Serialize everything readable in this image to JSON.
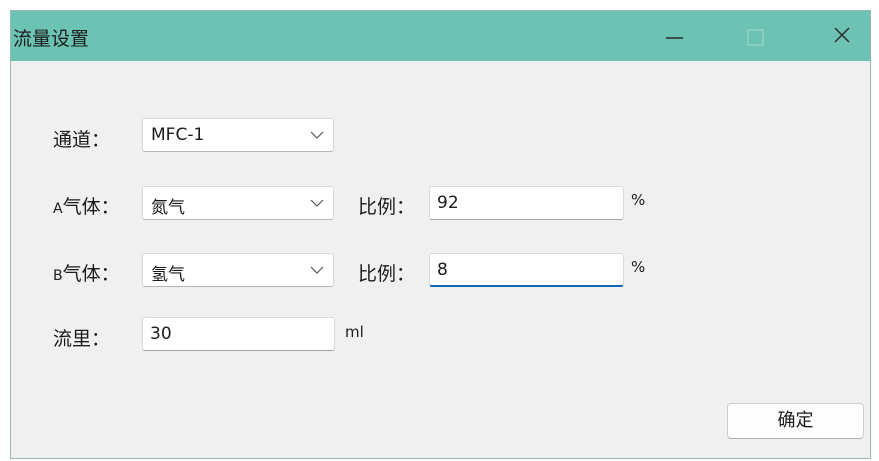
{
  "window": {
    "title": "流量设置",
    "titlebar_color": "#6cc2b3"
  },
  "titlebar_buttons": {
    "minimize": "minimize-icon",
    "maximize": "maximize-icon",
    "close": "close-icon"
  },
  "channel": {
    "label": "通道：",
    "value": "MFC-1"
  },
  "gas_a": {
    "prefix": "A",
    "label": "气体：",
    "value": "氮气",
    "ratio_label": "比例：",
    "ratio_value": "92",
    "ratio_unit": "%"
  },
  "gas_b": {
    "prefix": "B",
    "label": "气体：",
    "value": "氢气",
    "ratio_label": "比例：",
    "ratio_value": "8",
    "ratio_unit": "%"
  },
  "flow": {
    "label": "流里：",
    "value": "30",
    "unit": "ml"
  },
  "actions": {
    "confirm_label": "确定"
  }
}
